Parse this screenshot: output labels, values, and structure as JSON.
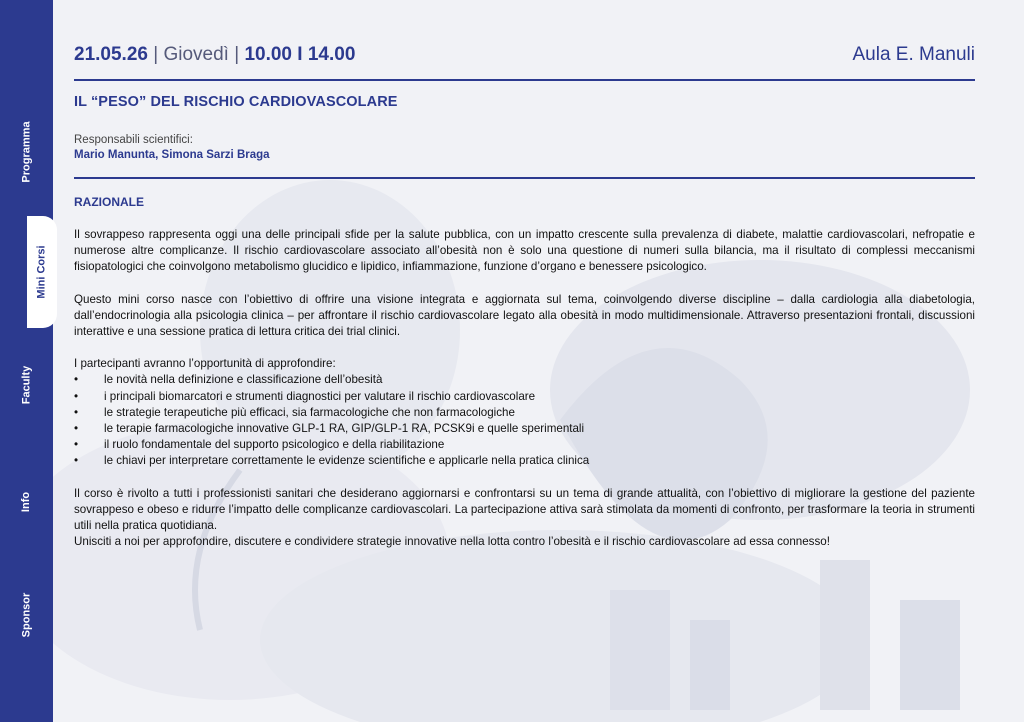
{
  "sidebar": {
    "items": [
      {
        "label": "Programma",
        "active": false
      },
      {
        "label": "Mini Corsi",
        "active": true
      },
      {
        "label": "Faculty",
        "active": false
      },
      {
        "label": "Info",
        "active": false
      },
      {
        "label": "Sponsor",
        "active": false
      }
    ]
  },
  "header": {
    "date": "21.05.26",
    "sep1": " | ",
    "day": "Giovedì",
    "sep2": " | ",
    "time": "10.00 I 14.00",
    "room": "Aula E. Manuli"
  },
  "course": {
    "title": "IL “PESO” DEL RISCHIO CARDIOVASCOLARE",
    "responsabili_label": "Responsabili scientifici:",
    "responsabili_names": "Mario Manunta, Simona Sarzi Braga",
    "section_title": "RAZIONALE",
    "paragraph1": "Il sovrappeso rappresenta oggi una delle principali sfide per la salute pubblica, con un impatto crescente sulla prevalenza di diabete, malattie cardiovascolari, nefropatie e numerose altre complicanze. Il rischio cardiovascolare associato all’obesità non è solo una questione di numeri sulla bilancia, ma il risultato di complessi meccanismi fisiopatologici che coinvolgono metabolismo glucidico e lipidico, infiammazione, funzione d’organo e benessere psicologico.",
    "paragraph2": "Questo mini corso nasce con l’obiettivo di offrire una visione integrata e aggiornata sul tema, coinvolgendo diverse discipline – dalla cardiologia alla diabetologia, dall’endocrinologia alla psicologia clinica – per affrontare il rischio cardiovascolare legato alla obesità in modo multidimensionale. Attraverso presentazioni frontali, discussioni interattive e una sessione pratica di lettura critica dei trial clinici.",
    "list_intro": "I partecipanti avranno l’opportunità di approfondire:",
    "bullets": [
      "le novità nella definizione e classificazione dell’obesità",
      "i principali biomarcatori e strumenti diagnostici per valutare il rischio cardiovascolare",
      "le strategie terapeutiche più efficaci, sia farmacologiche che non farmacologiche",
      "le terapie farmacologiche innovative GLP-1 RA, GIP/GLP-1 RA, PCSK9i e quelle sperimentali",
      "il ruolo fondamentale del supporto psicologico e della riabilitazione",
      "le chiavi per interpretare correttamente le evidenze scientifiche e applicarle nella pratica clinica"
    ],
    "paragraph3": "Il corso è rivolto a tutti i professionisti sanitari che desiderano aggiornarsi e confrontarsi su un tema di grande attualità, con l’obiettivo di migliorare la gestione del paziente sovrappeso e obeso e ridurre l’impatto delle complicanze cardiovascolari. La partecipazione attiva sarà stimolata da momenti di confronto, per trasformare la teoria in strumenti utili nella pratica quotidiana.",
    "paragraph4": "Unisciti a noi per approfondire, discutere e condividere strategie innovative nella lotta contro l’obesità e il rischio cardiovascolare ad essa connesso!"
  },
  "colors": {
    "brand": "#2c3a8f",
    "background": "#f1f2f6",
    "text": "#111111"
  }
}
